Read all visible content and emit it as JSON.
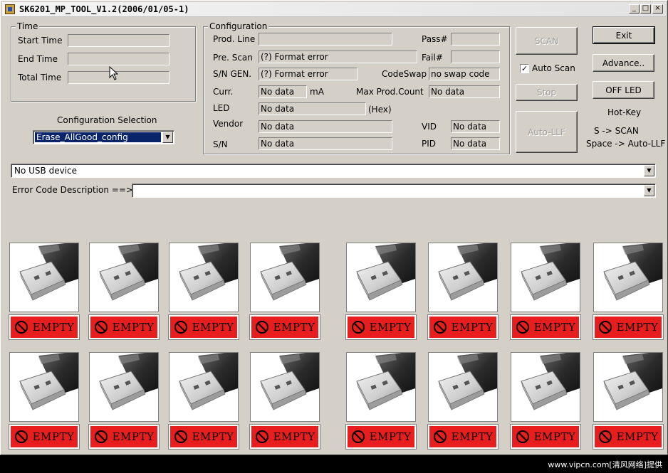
{
  "window": {
    "title": "SK6201_MP_TOOL_V1.2(2006/01/05-1)"
  },
  "time_group": {
    "title": "Time",
    "start_label": "Start Time",
    "end_label": "End Time",
    "total_label": "Total Time",
    "start_value": "",
    "end_value": "",
    "total_value": ""
  },
  "config_selection": {
    "label": "Configuration Selection",
    "selected": "Erase_AllGood_config"
  },
  "configuration": {
    "title": "Configuration",
    "prod_line_label": "Prod. Line",
    "prod_line_value": "",
    "pass_label": "Pass#",
    "pass_value": "",
    "fail_label": "Fail#",
    "fail_value": "",
    "pre_scan_label": "Pre. Scan",
    "pre_scan_value": "(?) Format error",
    "sn_gen_label": "S/N GEN.",
    "sn_gen_value": "(?) Format error",
    "codeswap_label": "CodeSwap",
    "codeswap_value": "no swap code",
    "curr_label": "Curr.",
    "curr_value": "No data",
    "curr_unit": "mA",
    "max_prod_label": "Max Prod.Count",
    "max_prod_value": "No data",
    "led_label": "LED",
    "led_value": "No data",
    "led_unit": "(Hex)",
    "vendor_label": "Vendor",
    "vendor_value": "No data",
    "vid_label": "VID",
    "vid_value": "No data",
    "sn_label": "S/N",
    "sn_value": "No data",
    "pid_label": "PID",
    "pid_value": "No data"
  },
  "controls": {
    "scan": "SCAN",
    "exit": "Exit",
    "advance": "Advance..",
    "auto_scan": "Auto Scan",
    "auto_scan_checked": true,
    "stop": "Stop",
    "off_led": "OFF LED",
    "auto_llf": "Auto-LLF"
  },
  "hotkeys": {
    "title": "Hot-Key",
    "scan": "S -> SCAN",
    "auto_llf": "Space -> Auto-LLF"
  },
  "usb_device": {
    "selected": "No USB device"
  },
  "error_code": {
    "label": "Error Code Description ==>",
    "selected": ""
  },
  "slots": [
    {
      "status": "EMPTY"
    },
    {
      "status": "EMPTY"
    },
    {
      "status": "EMPTY"
    },
    {
      "status": "EMPTY"
    },
    {
      "status": "EMPTY"
    },
    {
      "status": "EMPTY"
    },
    {
      "status": "EMPTY"
    },
    {
      "status": "EMPTY"
    },
    {
      "status": "EMPTY"
    },
    {
      "status": "EMPTY"
    },
    {
      "status": "EMPTY"
    },
    {
      "status": "EMPTY"
    },
    {
      "status": "EMPTY"
    },
    {
      "status": "EMPTY"
    },
    {
      "status": "EMPTY"
    },
    {
      "status": "EMPTY"
    }
  ],
  "icons": {
    "slot_image": "usb-drive-icon",
    "status": "prohibited-icon"
  },
  "colors": {
    "empty_status": "#e81e1e",
    "selection": "#0a246a"
  },
  "footer": "www.vipcn.com[清风网络]提供"
}
